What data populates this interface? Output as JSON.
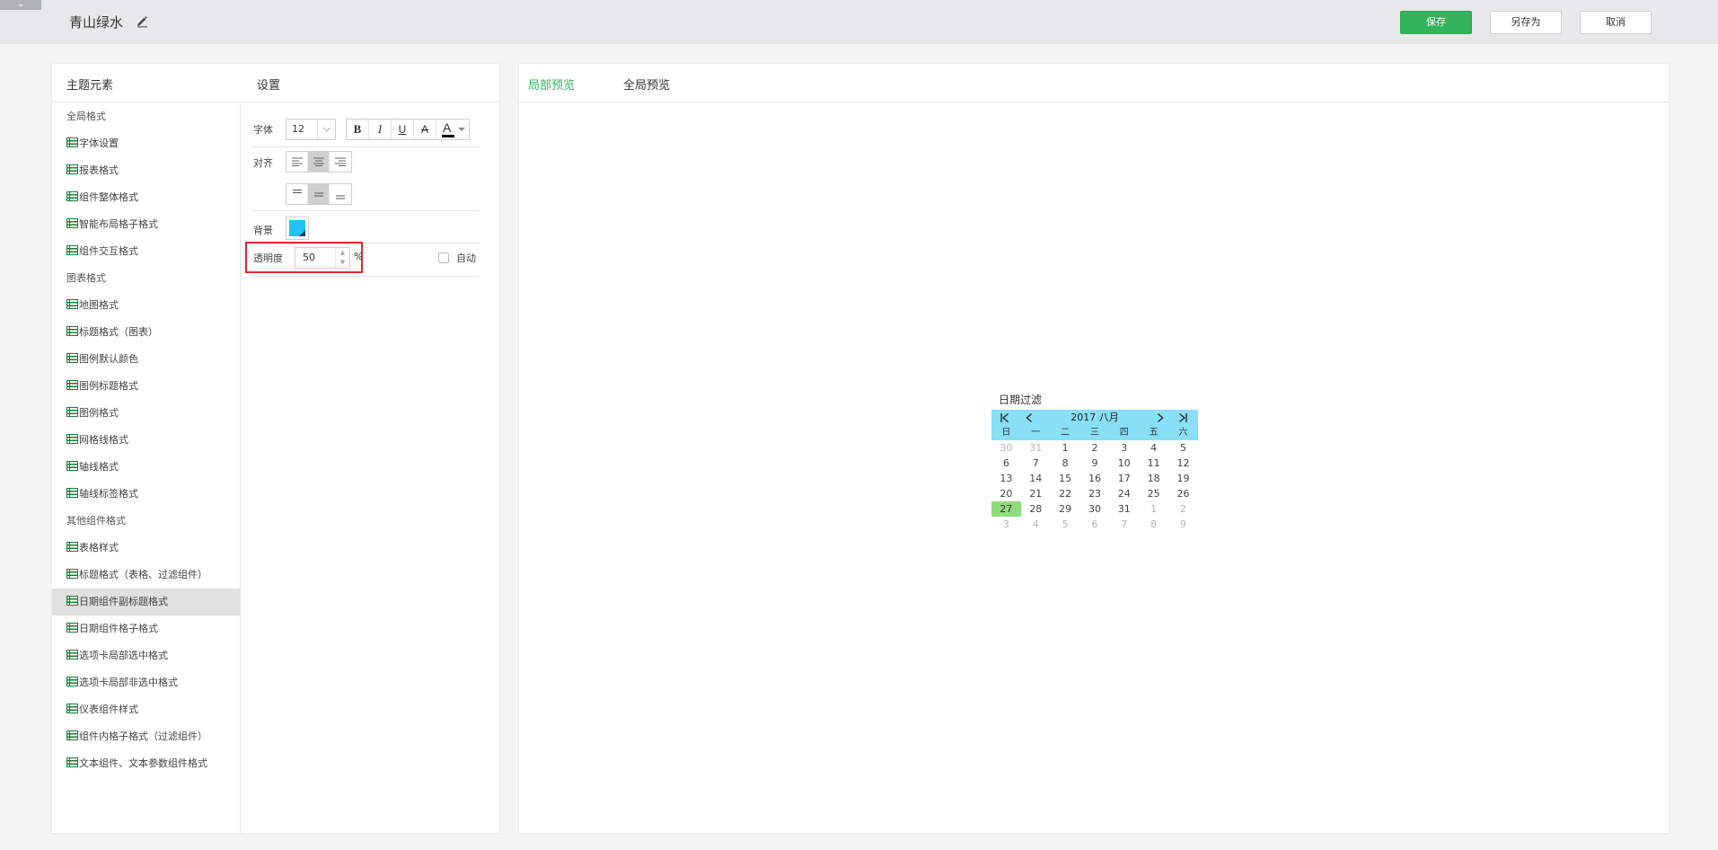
{
  "header": {
    "collapse_icon": "chevron-down-icon",
    "theme_name": "青山绿水",
    "edit_icon": "pencil-icon",
    "save_label": "保存",
    "save_as_label": "另存为",
    "cancel_label": "取消",
    "accent_color": "#31b45b"
  },
  "left_panel": {
    "elements_header": "主题元素",
    "settings_header": "设置",
    "tree": [
      {
        "type": "group",
        "label": "全局格式"
      },
      {
        "type": "leaf",
        "label": "字体设置"
      },
      {
        "type": "leaf",
        "label": "报表格式"
      },
      {
        "type": "leaf",
        "label": "组件整体格式"
      },
      {
        "type": "leaf",
        "label": "智能布局格子格式"
      },
      {
        "type": "leaf",
        "label": "组件交互格式"
      },
      {
        "type": "group",
        "label": "图表格式"
      },
      {
        "type": "leaf",
        "label": "地图格式"
      },
      {
        "type": "leaf",
        "label": "标题格式（图表）"
      },
      {
        "type": "leaf",
        "label": "图例默认颜色"
      },
      {
        "type": "leaf",
        "label": "图例标题格式"
      },
      {
        "type": "leaf",
        "label": "图例格式"
      },
      {
        "type": "leaf",
        "label": "网格线格式"
      },
      {
        "type": "leaf",
        "label": "轴线格式"
      },
      {
        "type": "leaf",
        "label": "轴线标签格式"
      },
      {
        "type": "group",
        "label": "其他组件格式"
      },
      {
        "type": "leaf",
        "label": "表格样式"
      },
      {
        "type": "leaf",
        "label": "标题格式（表格、过滤组件）"
      },
      {
        "type": "leaf",
        "label": "日期组件副标题格式",
        "selected": true
      },
      {
        "type": "leaf",
        "label": "日期组件格子格式"
      },
      {
        "type": "leaf",
        "label": "选项卡局部选中格式"
      },
      {
        "type": "leaf",
        "label": "选项卡局部非选中格式"
      },
      {
        "type": "leaf",
        "label": "仪表组件样式"
      },
      {
        "type": "leaf",
        "label": "组件内格子格式（过滤组件）"
      },
      {
        "type": "leaf",
        "label": "文本组件、文本参数组件格式"
      }
    ]
  },
  "settings": {
    "font_label": "字体",
    "font_size": "12",
    "bold": "B",
    "italic": "I",
    "underline": "U",
    "strike": "A",
    "font_color": "A",
    "align_label": "对齐",
    "background_label": "背景",
    "background_color": "#22c3f3",
    "opacity_label": "透明度",
    "opacity_value": "50",
    "opacity_unit": "%",
    "auto_label": "自动",
    "auto_checked": false
  },
  "preview": {
    "tab_local": "局部预览",
    "tab_global": "全局预览",
    "calendar": {
      "title": "日期过滤",
      "month_label": "2017 八月",
      "header_color": "#88dff6",
      "today_color": "#8ddd7c",
      "weekdays": [
        "日",
        "一",
        "二",
        "三",
        "四",
        "五",
        "六"
      ],
      "weeks": [
        [
          {
            "d": "30",
            "m": true
          },
          {
            "d": "31",
            "m": true
          },
          {
            "d": "1"
          },
          {
            "d": "2"
          },
          {
            "d": "3"
          },
          {
            "d": "4"
          },
          {
            "d": "5"
          }
        ],
        [
          {
            "d": "6"
          },
          {
            "d": "7"
          },
          {
            "d": "8"
          },
          {
            "d": "9"
          },
          {
            "d": "10"
          },
          {
            "d": "11"
          },
          {
            "d": "12"
          }
        ],
        [
          {
            "d": "13"
          },
          {
            "d": "14"
          },
          {
            "d": "15"
          },
          {
            "d": "16"
          },
          {
            "d": "17"
          },
          {
            "d": "18"
          },
          {
            "d": "19"
          }
        ],
        [
          {
            "d": "20"
          },
          {
            "d": "21"
          },
          {
            "d": "22"
          },
          {
            "d": "23"
          },
          {
            "d": "24"
          },
          {
            "d": "25"
          },
          {
            "d": "26"
          }
        ],
        [
          {
            "d": "27",
            "t": true
          },
          {
            "d": "28"
          },
          {
            "d": "29"
          },
          {
            "d": "30"
          },
          {
            "d": "31"
          },
          {
            "d": "1",
            "m": true
          },
          {
            "d": "2",
            "m": true
          }
        ],
        [
          {
            "d": "3",
            "m": true
          },
          {
            "d": "4",
            "m": true
          },
          {
            "d": "5",
            "m": true
          },
          {
            "d": "6",
            "m": true
          },
          {
            "d": "7",
            "m": true
          },
          {
            "d": "8",
            "m": true
          },
          {
            "d": "9",
            "m": true
          }
        ]
      ]
    }
  }
}
